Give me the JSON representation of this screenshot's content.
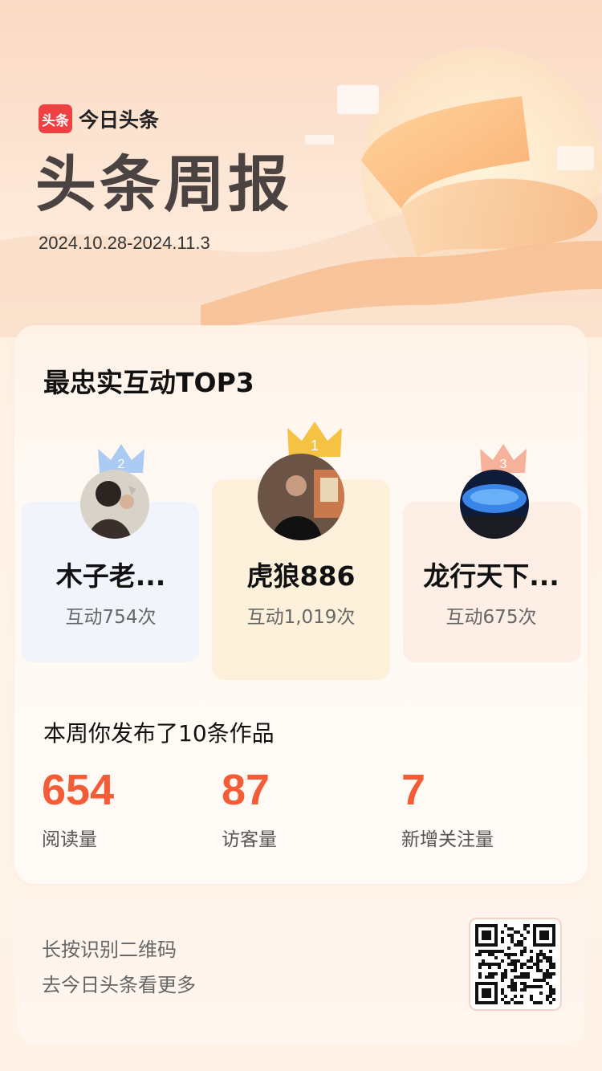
{
  "header": {
    "logo_mark": "头条",
    "logo_text": "今日头条",
    "title": "头条周报",
    "date_range": "2024.10.28-2024.11.3"
  },
  "top3": {
    "title": "最忠实互动TOP3",
    "items": [
      {
        "rank": "2",
        "name": "木子老...",
        "count": "互动754次",
        "crown_color": "#9ec3f2",
        "panel_color": "#eef3fb"
      },
      {
        "rank": "1",
        "name": "虎狼886",
        "count": "互动1,019次",
        "crown_color": "#f6c244",
        "panel_color": "#fdf0d8"
      },
      {
        "rank": "3",
        "name": "龙行天下...",
        "count": "互动675次",
        "crown_color": "#f4a58b",
        "panel_color": "#fdebe2"
      }
    ]
  },
  "publish": {
    "title": "本周你发布了10条作品",
    "stats": [
      {
        "value": "654",
        "label": "阅读量"
      },
      {
        "value": "87",
        "label": "访客量"
      },
      {
        "value": "7",
        "label": "新增关注量"
      }
    ]
  },
  "footer": {
    "line1": "长按识别二维码",
    "line2": "去今日头条看更多"
  },
  "colors": {
    "accent": "#f25d38",
    "brand": "#f04142"
  }
}
